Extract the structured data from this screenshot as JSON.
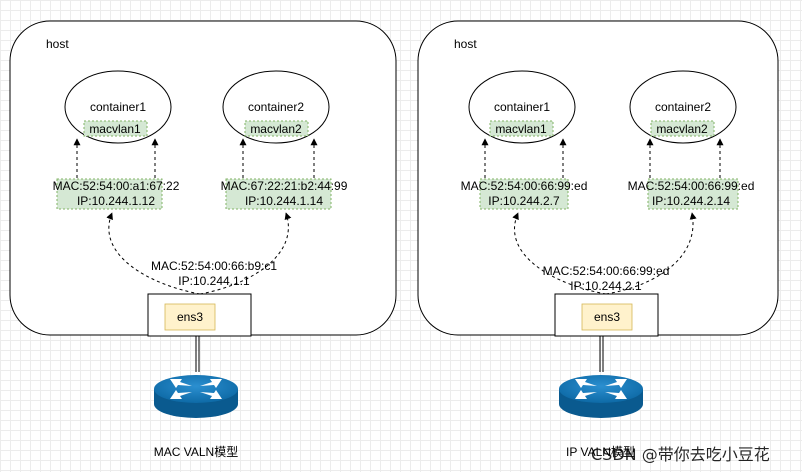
{
  "left": {
    "host_label": "host",
    "container1": {
      "name": "container1",
      "iface": "macvlan1",
      "mac": "MAC:52:54:00:a1:67:22",
      "ip": "IP:10.244.1.12"
    },
    "container2": {
      "name": "container2",
      "iface": "macvlan2",
      "mac": "MAC:67:22:21:b2:44:99",
      "ip": "IP:10.244.1.14"
    },
    "host_mac": "MAC:52:54:00:66:b9:c1",
    "host_ip": "IP:10.244.1.1",
    "nic": "ens3",
    "caption": "MAC VALN模型"
  },
  "right": {
    "host_label": "host",
    "container1": {
      "name": "container1",
      "iface": "macvlan1",
      "mac": "MAC:52:54:00:66:99:ed",
      "ip": "IP:10.244.2.7"
    },
    "container2": {
      "name": "container2",
      "iface": "macvlan2",
      "mac": "MAC:52:54:00:66:99:ed",
      "ip": "IP:10.244.2.14"
    },
    "host_mac": "MAC:52:54:00:66:99:ed",
    "host_ip": "IP:10.244.2.1",
    "nic": "ens3",
    "caption": "IP VALN模型"
  },
  "watermark": "CSDN @带你去吃小豆花",
  "colors": {
    "label_fill": "#d5e8d4",
    "label_stroke": "#82b366",
    "nic_fill": "#fff2cc",
    "router": "#0e6aa6"
  },
  "icons": {
    "router": "router-icon"
  }
}
